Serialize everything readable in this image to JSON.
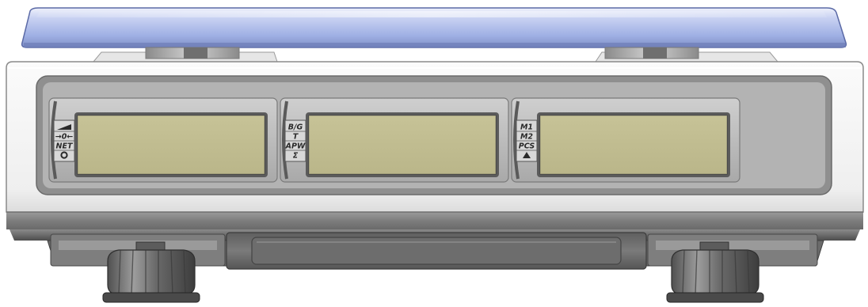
{
  "panels": [
    {
      "indicators": [
        {
          "icon": "stability-indicator-icon",
          "label": ""
        },
        {
          "icon": "zero-indicator-icon",
          "label": "→0←"
        },
        {
          "icon": "net-indicator",
          "label": "NET"
        },
        {
          "icon": "power-indicator-icon",
          "label": ""
        }
      ],
      "display_text": ""
    },
    {
      "indicators": [
        {
          "icon": "bg-indicator",
          "label": "B/G"
        },
        {
          "icon": "tare-indicator",
          "label": "T"
        },
        {
          "icon": "apw-indicator",
          "label": "APW"
        },
        {
          "icon": "sum-indicator",
          "label": "Σ"
        }
      ],
      "display_text": ""
    },
    {
      "indicators": [
        {
          "icon": "m1-indicator",
          "label": "M1"
        },
        {
          "icon": "m2-indicator",
          "label": "M2"
        },
        {
          "icon": "pcs-indicator",
          "label": "PCS"
        },
        {
          "icon": "triangle-indicator-icon",
          "label": "▲"
        }
      ],
      "display_text": ""
    }
  ],
  "colors": {
    "lcd": "#c0bc8f",
    "pan": "#b8c4ec",
    "body": "#f2f2f2",
    "base": "#7a7a7a"
  }
}
